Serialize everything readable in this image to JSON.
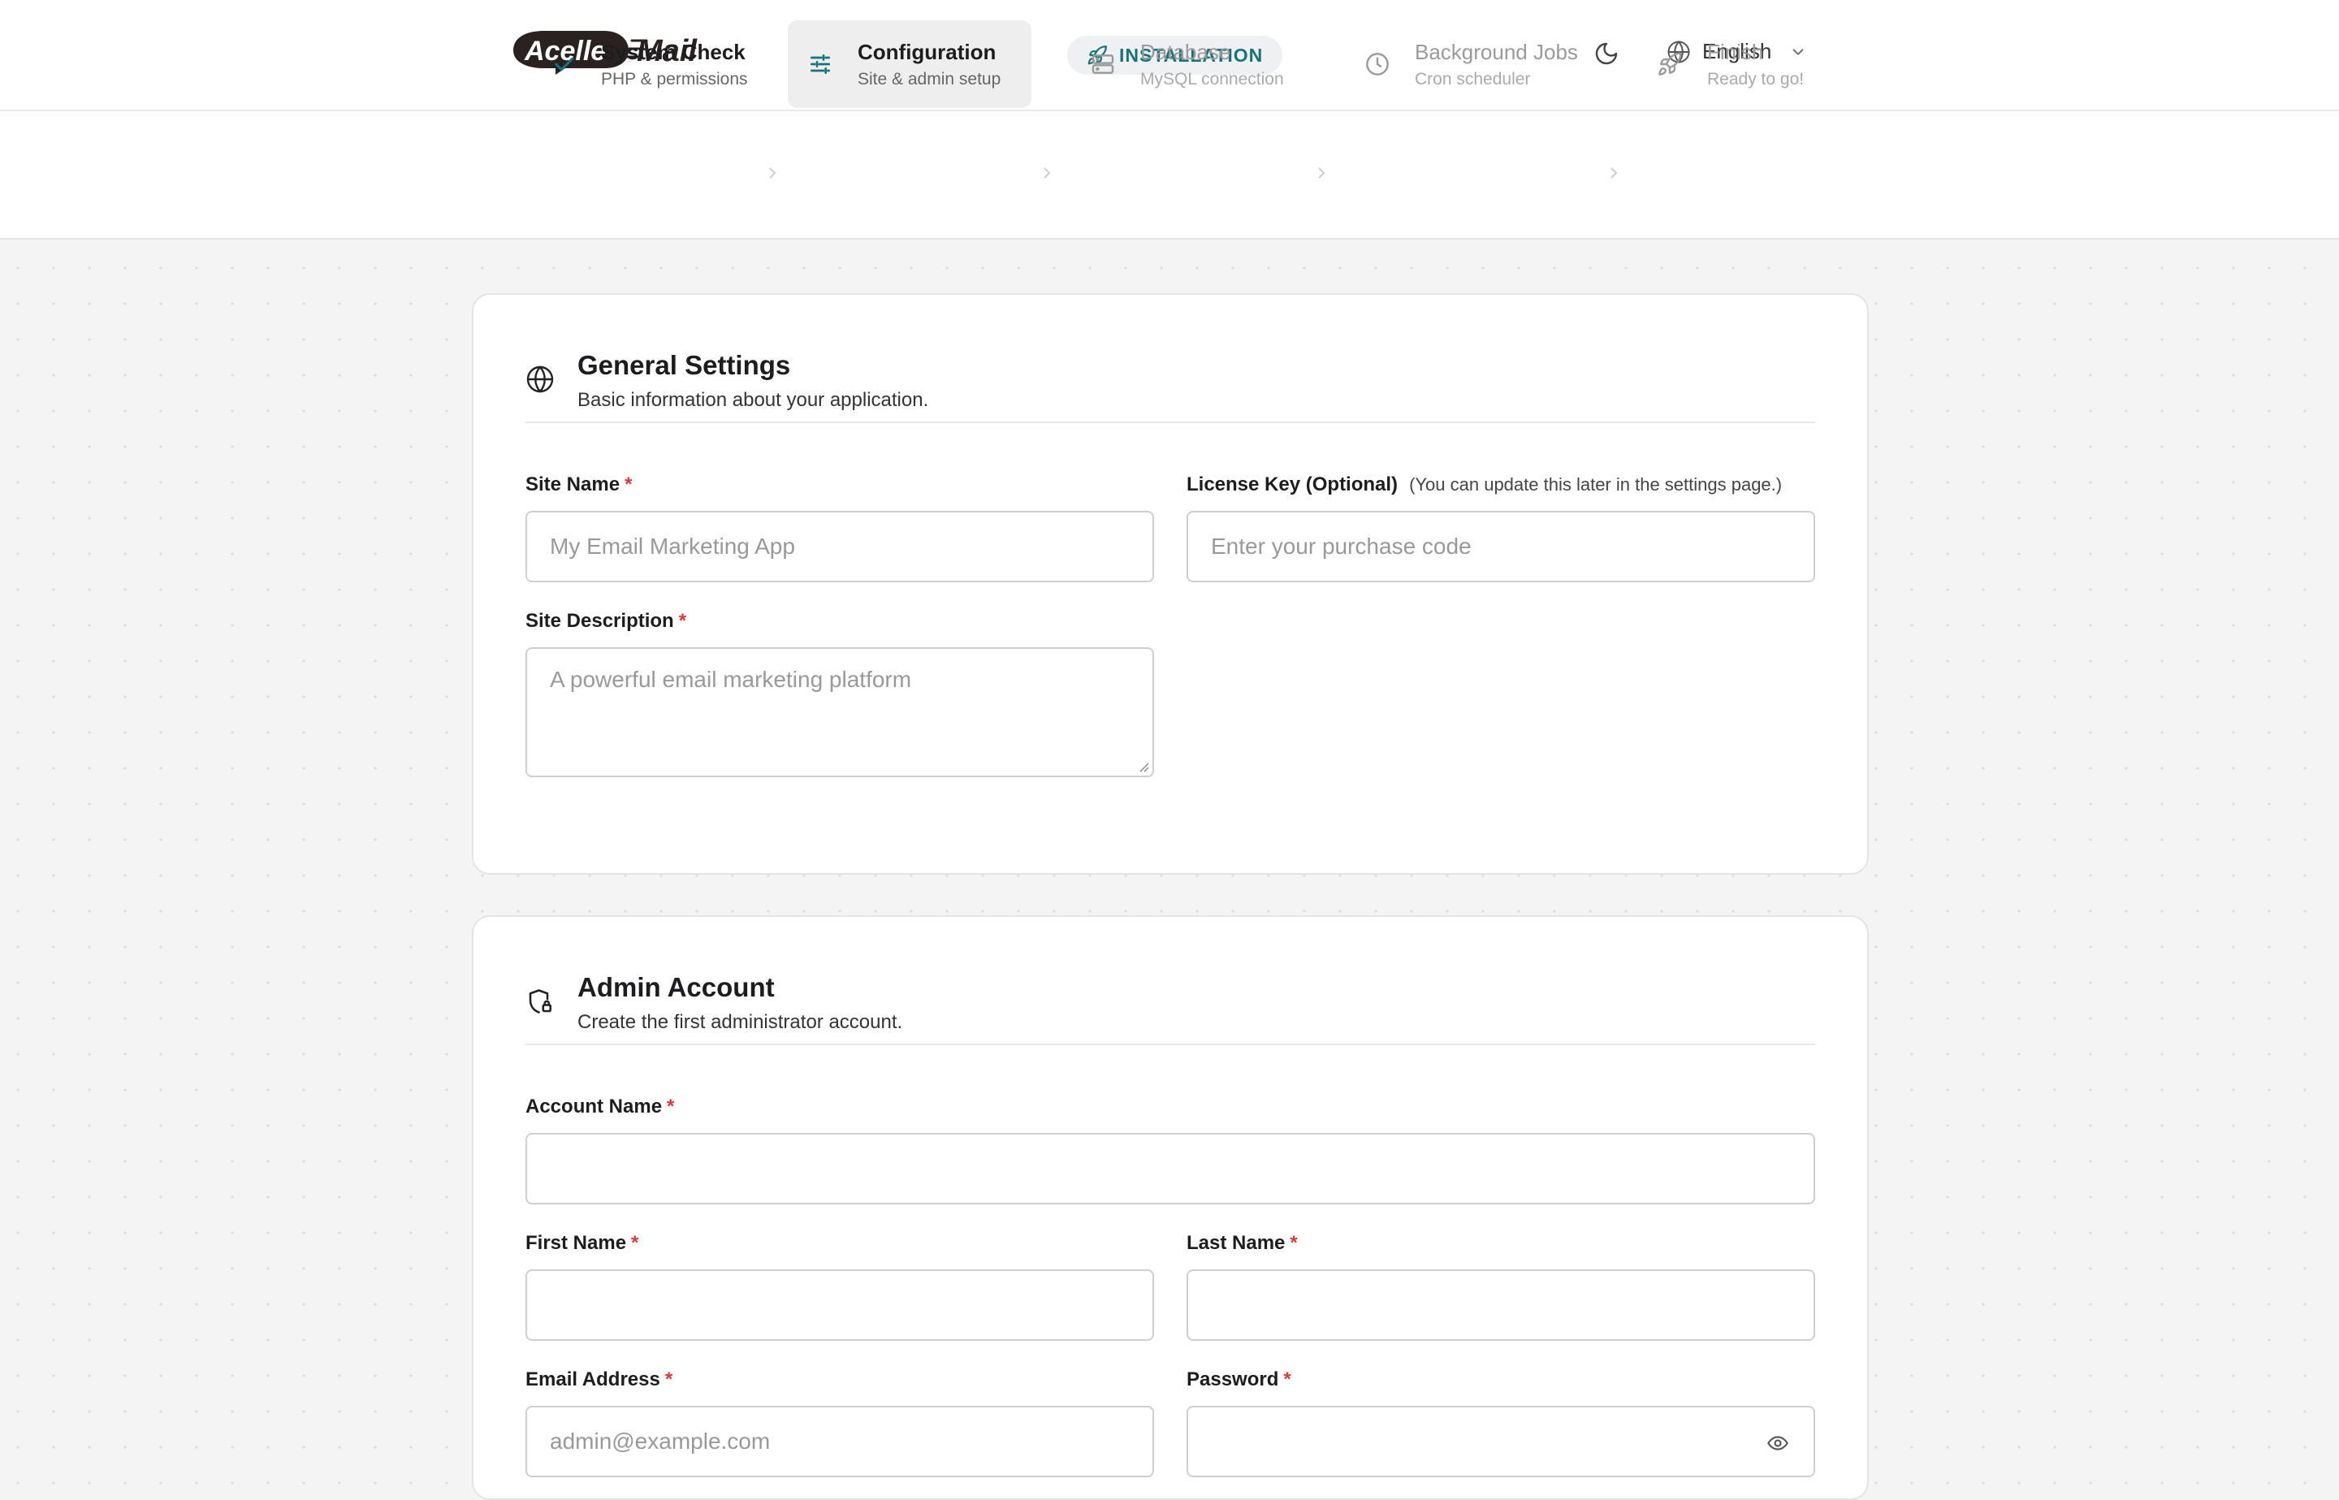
{
  "header": {
    "logo_text": "Acelle Mail",
    "badge": "INSTALLATION",
    "language": "English",
    "icons": [
      "rocket-icon",
      "moon-icon",
      "globe-icon",
      "chevron-down-icon"
    ]
  },
  "steps": [
    {
      "title": "System Check",
      "subtitle": "PHP & permissions",
      "state": "done",
      "icon": "check-icon"
    },
    {
      "title": "Configuration",
      "subtitle": "Site & admin setup",
      "state": "active",
      "icon": "sliders-icon"
    },
    {
      "title": "Database",
      "subtitle": "MySQL connection",
      "state": "pending",
      "icon": "server-icon"
    },
    {
      "title": "Background Jobs",
      "subtitle": "Cron scheduler",
      "state": "pending",
      "icon": "clock-icon"
    },
    {
      "title": "Finish",
      "subtitle": "Ready to go!",
      "state": "pending",
      "icon": "rocket-icon"
    }
  ],
  "general": {
    "title": "General Settings",
    "subtitle": "Basic information about your application.",
    "site_name_label": "Site Name",
    "site_name_placeholder": "My Email Marketing App",
    "license_label": "License Key (Optional)",
    "license_note": "(You can update this later in the settings page.)",
    "license_placeholder": "Enter your purchase code",
    "site_desc_label": "Site Description",
    "site_desc_placeholder": "A powerful email marketing platform"
  },
  "admin": {
    "title": "Admin Account",
    "subtitle": "Create the first administrator account.",
    "account_name_label": "Account Name",
    "account_name_value": "",
    "first_name_label": "First Name",
    "first_name_value": "",
    "last_name_label": "Last Name",
    "last_name_value": "",
    "email_label": "Email Address",
    "email_placeholder": "admin@example.com",
    "password_label": "Password",
    "password_value": ""
  },
  "required_marker": "*",
  "colors": {
    "accent": "#17727a",
    "required": "#d93a3a",
    "badge_bg": "#eef0f1"
  }
}
